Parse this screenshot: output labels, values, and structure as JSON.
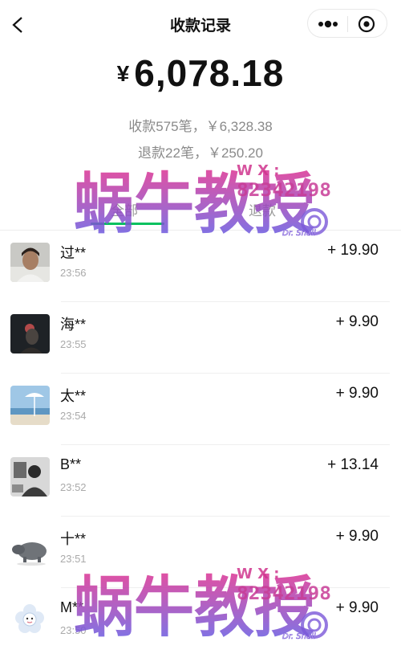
{
  "nav": {
    "title": "收款记录"
  },
  "summary": {
    "currency": "¥",
    "total": "6,078.18",
    "receipts_line": "收款575笔，￥6,328.38",
    "refunds_line": "退款22笔，￥250.20"
  },
  "tabs": [
    {
      "label": "全部",
      "active": true
    },
    {
      "label": "退款",
      "active": false
    }
  ],
  "transactions": [
    {
      "name": "过**",
      "time": "23:56",
      "amount": "+ 19.90",
      "avatar": "portrait-photo"
    },
    {
      "name": "海**",
      "time": "23:55",
      "amount": "+ 9.90",
      "avatar": "dark-portrait-photo"
    },
    {
      "name": "太**",
      "time": "23:54",
      "amount": "+ 9.90",
      "avatar": "beach-photo"
    },
    {
      "name": "B**",
      "time": "23:52",
      "amount": "+ 13.14",
      "avatar": "monochrome-photo"
    },
    {
      "name": "十**",
      "time": "23:51",
      "amount": "+ 9.90",
      "avatar": "hippo-photo"
    },
    {
      "name": "M**",
      "time": "23:50",
      "amount": "+ 9.90",
      "avatar": "flower-cartoon"
    }
  ],
  "watermark": {
    "brand": "蜗牛教授",
    "wx_label": "W X :",
    "wx_id": "82342198",
    "sub": "Dr. Snail"
  },
  "colors": {
    "tab_accent": "#07c160",
    "watermark_pink": "#d03aa0",
    "watermark_violet": "#6a5ae0"
  }
}
